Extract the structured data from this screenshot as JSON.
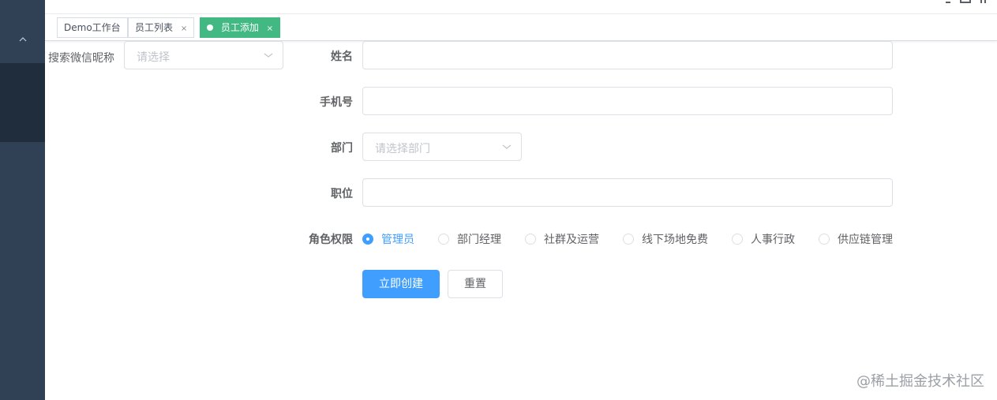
{
  "sidebar": {
    "collapse_icon": "chevron-up-icon"
  },
  "navbar": {
    "icons": [
      "search-icon",
      "fullscreen-icon",
      "size-icon"
    ]
  },
  "tags": [
    {
      "label": "Demo工作台",
      "closable": false,
      "active": false
    },
    {
      "label": "员工列表",
      "closable": true,
      "active": false
    },
    {
      "label": "员工添加",
      "closable": true,
      "active": true
    }
  ],
  "tag_close": "×",
  "search": {
    "label": "搜索微信昵称",
    "placeholder": "请选择"
  },
  "form": {
    "name_label": "姓名",
    "phone_label": "手机号",
    "dept_label": "部门",
    "dept_placeholder": "请选择部门",
    "position_label": "职位",
    "role_label": "角色权限",
    "roles": [
      "管理员",
      "部门经理",
      "社群及运营",
      "线下场地免费",
      "人事行政",
      "供应链管理"
    ],
    "selected_role": "管理员",
    "submit_label": "立即创建",
    "reset_label": "重置"
  },
  "watermark": "@稀土掘金技术社区",
  "colors": {
    "sidebar": "#304156",
    "sidebar_active": "#1f2d3d",
    "tag_active": "#42b983",
    "primary": "#409eff"
  }
}
